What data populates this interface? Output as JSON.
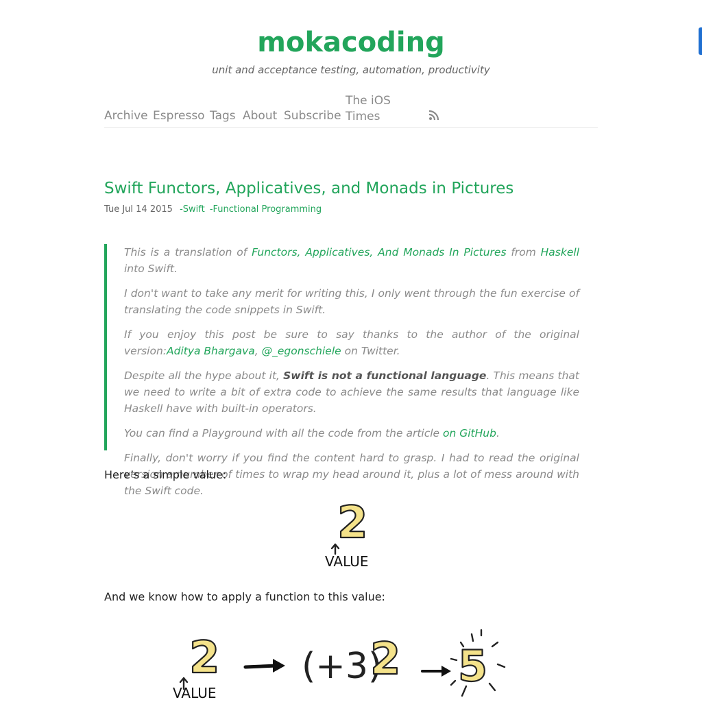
{
  "site": {
    "title": "mokacoding",
    "tagline": "unit and acceptance testing, automation, productivity"
  },
  "nav": {
    "items": [
      "Archive",
      "Espresso",
      "Tags",
      "About",
      "Subscribe"
    ],
    "ios_times_line1": "The iOS",
    "ios_times_line2": "Times",
    "rss_icon": "rss-icon"
  },
  "post": {
    "title": "Swift Functors, Applicatives, and Monads in Pictures",
    "date": "Tue Jul 14 2015",
    "tags": [
      "-Swift",
      "-Functional Programming"
    ]
  },
  "quote": {
    "p1_a": "This is a translation of ",
    "p1_link1": "Functors, Applicatives, And Monads In Pictures",
    "p1_b": " from ",
    "p1_link2": "Haskell",
    "p1_c": " into Swift.",
    "p2": "I don't want to take any merit for writing this, I only went through the fun exercise of translating the code snippets in Swift.",
    "p3_a": "If you enjoy this post be sure to say thanks to the author of the original version:",
    "p3_link1": "Aditya Bhargava",
    "p3_b": ", ",
    "p3_link2": "@_egonschiele",
    "p3_c": " on Twitter.",
    "p4_a": "Despite all the hype about it, ",
    "p4_bold": "Swift is not a functional language",
    "p4_b": ". This means that we need to write a bit of extra code to achieve the same results that language like Haskell have with built-in operators.",
    "p5_a": "You can find a Playground with all the code from the article ",
    "p5_link": "on GitHub",
    "p5_b": ".",
    "p6": "Finally, don't worry if you find the content hard to grasp. I had to read the original version a number of times to wrap my head around it, plus a lot of mess around with the Swift code."
  },
  "body": {
    "p1": "Here’s a simple value:",
    "p2": "And we know how to apply a function to this value:"
  },
  "figures": {
    "value_label": "VALUE",
    "two": "2",
    "five": "5",
    "func_text": "(+3)"
  },
  "colors": {
    "accent": "#22a55b",
    "number_fill": "#f4e28a",
    "side_tab": "#1f6fd1"
  }
}
